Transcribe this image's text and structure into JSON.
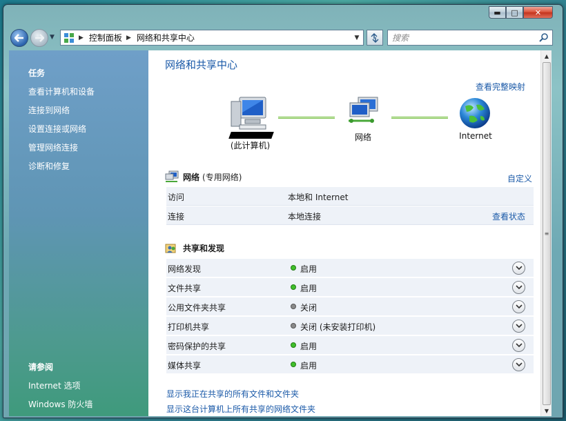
{
  "window": {
    "buttons": {
      "minimize": "▬",
      "maximize": "□",
      "close": "✕"
    }
  },
  "nav": {
    "breadcrumb": [
      "控制面板",
      "网络和共享中心"
    ],
    "search_placeholder": "搜索"
  },
  "sidebar": {
    "tasks_heading": "任务",
    "tasks": [
      "查看计算机和设备",
      "连接到网络",
      "设置连接或网络",
      "管理网络连接",
      "诊断和修复"
    ],
    "see_also_heading": "请参阅",
    "see_also": [
      "Internet 选项",
      "Windows 防火墙"
    ]
  },
  "main": {
    "title": "网络和共享中心",
    "view_full_map": "查看完整映射",
    "map": {
      "this_computer": "(此计算机)",
      "network": "网络",
      "internet": "Internet"
    },
    "network_section": {
      "name": "网络",
      "type": "(专用网络)",
      "customize": "自定义",
      "rows": [
        {
          "label": "访问",
          "value": "本地和 Internet",
          "action": ""
        },
        {
          "label": "连接",
          "value": "本地连接",
          "action": "查看状态"
        }
      ]
    },
    "sharing_section": {
      "title": "共享和发现",
      "rows": [
        {
          "label": "网络发现",
          "status": "on",
          "value": "启用"
        },
        {
          "label": "文件共享",
          "status": "on",
          "value": "启用"
        },
        {
          "label": "公用文件夹共享",
          "status": "off",
          "value": "关闭"
        },
        {
          "label": "打印机共享",
          "status": "off",
          "value": "关闭 (未安装打印机)"
        },
        {
          "label": "密码保护的共享",
          "status": "on",
          "value": "启用"
        },
        {
          "label": "媒体共享",
          "status": "on",
          "value": "启用"
        }
      ]
    },
    "footer_links": [
      "显示我正在共享的所有文件和文件夹",
      "显示这台计算机上所有共享的网络文件夹"
    ]
  },
  "colors": {
    "on": "#3fbf2a",
    "off": "#8a8a8a",
    "link": "#1b5aa8"
  }
}
